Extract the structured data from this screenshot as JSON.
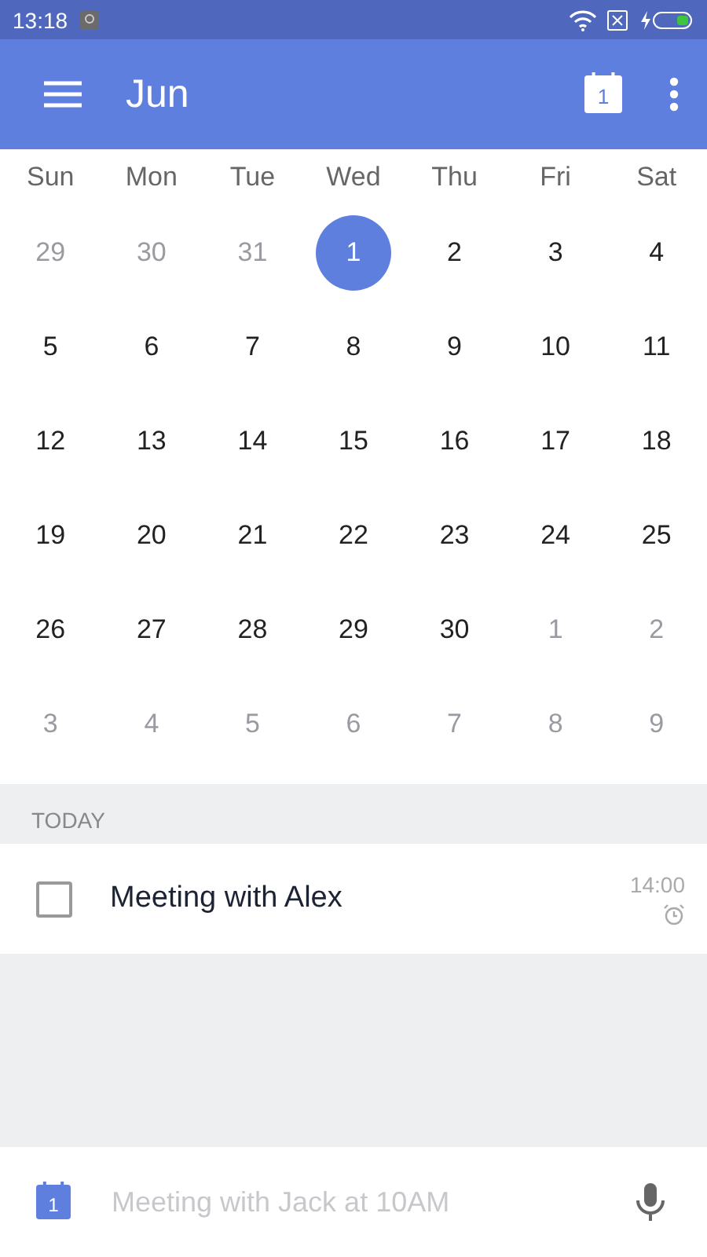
{
  "status_bar": {
    "time": "13:18"
  },
  "app_bar": {
    "title": "Jun",
    "today_icon_label": "1"
  },
  "calendar": {
    "weekdays": [
      "Sun",
      "Mon",
      "Tue",
      "Wed",
      "Thu",
      "Fri",
      "Sat"
    ],
    "days": [
      {
        "text": "29",
        "muted": true,
        "selected": false
      },
      {
        "text": "30",
        "muted": true,
        "selected": false
      },
      {
        "text": "31",
        "muted": true,
        "selected": false
      },
      {
        "text": "1",
        "muted": false,
        "selected": true
      },
      {
        "text": "2",
        "muted": false,
        "selected": false
      },
      {
        "text": "3",
        "muted": false,
        "selected": false
      },
      {
        "text": "4",
        "muted": false,
        "selected": false
      },
      {
        "text": "5",
        "muted": false,
        "selected": false
      },
      {
        "text": "6",
        "muted": false,
        "selected": false
      },
      {
        "text": "7",
        "muted": false,
        "selected": false
      },
      {
        "text": "8",
        "muted": false,
        "selected": false
      },
      {
        "text": "9",
        "muted": false,
        "selected": false
      },
      {
        "text": "10",
        "muted": false,
        "selected": false
      },
      {
        "text": "11",
        "muted": false,
        "selected": false
      },
      {
        "text": "12",
        "muted": false,
        "selected": false
      },
      {
        "text": "13",
        "muted": false,
        "selected": false
      },
      {
        "text": "14",
        "muted": false,
        "selected": false
      },
      {
        "text": "15",
        "muted": false,
        "selected": false
      },
      {
        "text": "16",
        "muted": false,
        "selected": false
      },
      {
        "text": "17",
        "muted": false,
        "selected": false
      },
      {
        "text": "18",
        "muted": false,
        "selected": false
      },
      {
        "text": "19",
        "muted": false,
        "selected": false
      },
      {
        "text": "20",
        "muted": false,
        "selected": false
      },
      {
        "text": "21",
        "muted": false,
        "selected": false
      },
      {
        "text": "22",
        "muted": false,
        "selected": false
      },
      {
        "text": "23",
        "muted": false,
        "selected": false
      },
      {
        "text": "24",
        "muted": false,
        "selected": false
      },
      {
        "text": "25",
        "muted": false,
        "selected": false
      },
      {
        "text": "26",
        "muted": false,
        "selected": false
      },
      {
        "text": "27",
        "muted": false,
        "selected": false
      },
      {
        "text": "28",
        "muted": false,
        "selected": false
      },
      {
        "text": "29",
        "muted": false,
        "selected": false
      },
      {
        "text": "30",
        "muted": false,
        "selected": false
      },
      {
        "text": "1",
        "muted": true,
        "selected": false
      },
      {
        "text": "2",
        "muted": true,
        "selected": false
      },
      {
        "text": "3",
        "muted": true,
        "selected": false
      },
      {
        "text": "4",
        "muted": true,
        "selected": false
      },
      {
        "text": "5",
        "muted": true,
        "selected": false
      },
      {
        "text": "6",
        "muted": true,
        "selected": false
      },
      {
        "text": "7",
        "muted": true,
        "selected": false
      },
      {
        "text": "8",
        "muted": true,
        "selected": false
      },
      {
        "text": "9",
        "muted": true,
        "selected": false
      }
    ]
  },
  "agenda": {
    "section": "TODAY",
    "events": [
      {
        "title": "Meeting with Alex",
        "time": "14:00",
        "checked": false,
        "alarm": true
      }
    ]
  },
  "composer": {
    "icon_label": "1",
    "placeholder": "Meeting with Jack at 10AM"
  }
}
